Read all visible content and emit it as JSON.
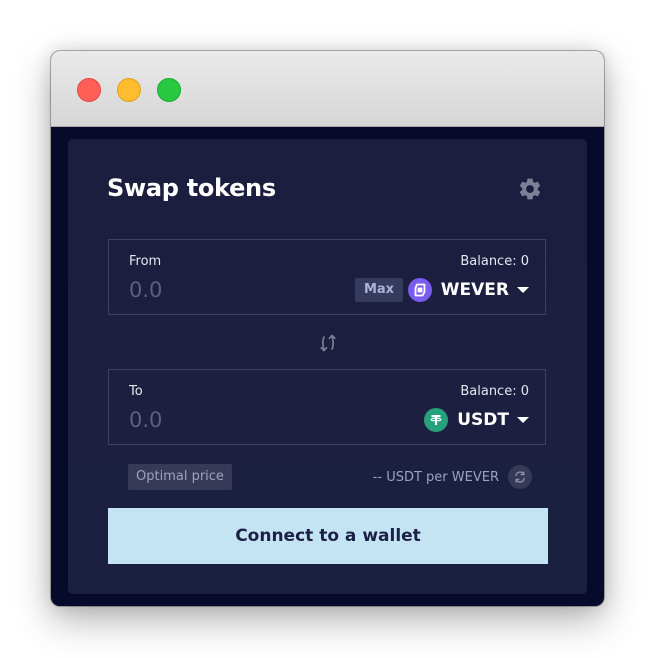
{
  "window": {
    "controls": [
      "close",
      "minimize",
      "maximize"
    ]
  },
  "swap": {
    "title": "Swap tokens",
    "settings_icon": "gear-icon",
    "from": {
      "label": "From",
      "balance": "Balance: 0",
      "amount_placeholder": "0.0",
      "max_label": "Max",
      "token": "WEVER",
      "token_icon": "wever-icon"
    },
    "switch_icon": "swap-arrows-icon",
    "to": {
      "label": "To",
      "balance": "Balance: 0",
      "amount_placeholder": "0.0",
      "token": "USDT",
      "token_icon": "tether-icon"
    },
    "price_badge": "Optimal price",
    "rate_text": "-- USDT per WEVER",
    "rate_toggle_icon": "refresh-icon",
    "connect_label": "Connect to a wallet"
  },
  "colors": {
    "background": "#070a2b",
    "card": "#1c1e3f",
    "accent_button": "#c5e4f3",
    "wever": "#7b5cf0",
    "usdt": "#26a17b"
  }
}
